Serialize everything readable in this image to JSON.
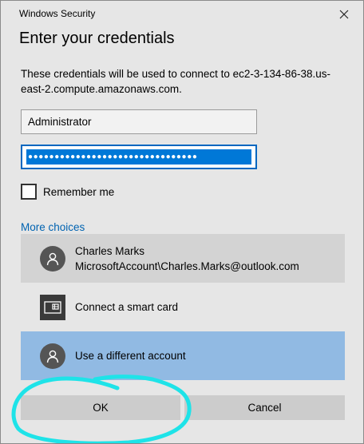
{
  "window": {
    "title": "Windows Security",
    "close_icon": "close-icon"
  },
  "heading": "Enter your credentials",
  "description": "These credentials will be used to connect to ec2-3-134-86-38.us-east-2.compute.amazonaws.com.",
  "username": {
    "value": "Administrator"
  },
  "password": {
    "masked": "●●●●●●●●●●●●●●●●●●●●●●●●●●●●●●●●"
  },
  "remember": {
    "label": "Remember me",
    "checked": false
  },
  "more_choices": {
    "label": "More choices",
    "options": [
      {
        "icon": "user-avatar-icon",
        "name": "Charles Marks",
        "detail": "MicrosoftAccount\\Charles.Marks@outlook.com"
      },
      {
        "icon": "smart-card-icon",
        "name": "Connect a smart card"
      },
      {
        "icon": "user-avatar-icon",
        "name": "Use a different account"
      }
    ]
  },
  "buttons": {
    "ok": "OK",
    "cancel": "Cancel"
  },
  "colors": {
    "dialog_bg": "#e6e6e6",
    "link": "#0063b1",
    "selection": "#0078d7",
    "selected_tile": "#91bae3",
    "hover_tile": "#d3d3d3",
    "button_bg": "#cccccc",
    "annotation": "#1ee3e8"
  }
}
